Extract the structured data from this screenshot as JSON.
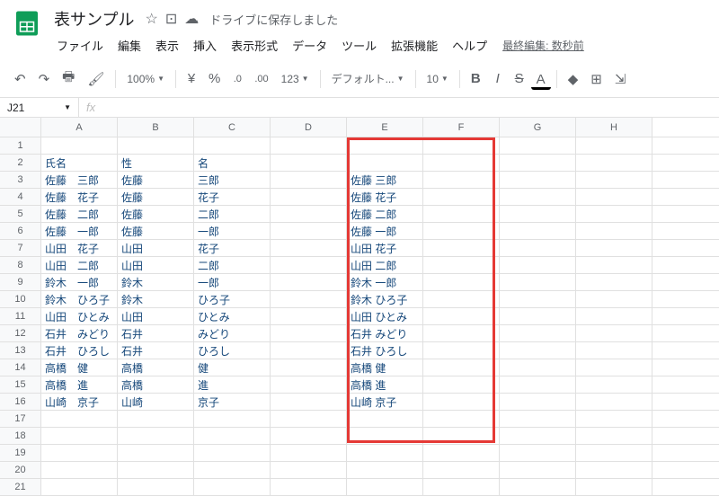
{
  "app": {
    "title": "表サンプル",
    "drive_saved": "ドライブに保存しました",
    "last_edit": "最終編集: 数秒前"
  },
  "menu": {
    "file": "ファイル",
    "edit": "編集",
    "view": "表示",
    "insert": "挿入",
    "format": "表示形式",
    "data": "データ",
    "tools": "ツール",
    "extensions": "拡張機能",
    "help": "ヘルプ"
  },
  "toolbar": {
    "zoom": "100%",
    "currency": "¥",
    "percent": "%",
    "dec_dec": ".0",
    "dec_inc": ".00",
    "more_fmt": "123",
    "font": "デフォルト...",
    "font_size": "10",
    "bold": "B",
    "italic": "I",
    "strike": "S",
    "text_color": "A"
  },
  "name_box": "J21",
  "fx": "fx",
  "columns": [
    "A",
    "B",
    "C",
    "D",
    "E",
    "F",
    "G",
    "H"
  ],
  "row_count": 21,
  "headers": {
    "a": "氏名",
    "b": "性",
    "c": "名"
  },
  "data_rows": [
    {
      "a": "佐藤　三郎",
      "b": "佐藤",
      "c": "三郎",
      "e": "佐藤 三郎"
    },
    {
      "a": "佐藤　花子",
      "b": "佐藤",
      "c": "花子",
      "e": "佐藤 花子"
    },
    {
      "a": "佐藤　二郎",
      "b": "佐藤",
      "c": "二郎",
      "e": "佐藤 二郎"
    },
    {
      "a": "佐藤　一郎",
      "b": "佐藤",
      "c": "一郎",
      "e": "佐藤 一郎"
    },
    {
      "a": "山田　花子",
      "b": "山田",
      "c": "花子",
      "e": "山田 花子"
    },
    {
      "a": "山田　二郎",
      "b": "山田",
      "c": "二郎",
      "e": "山田 二郎"
    },
    {
      "a": "鈴木　一郎",
      "b": "鈴木",
      "c": "一郎",
      "e": "鈴木 一郎"
    },
    {
      "a": "鈴木　ひろ子",
      "b": "鈴木",
      "c": "ひろ子",
      "e": "鈴木 ひろ子"
    },
    {
      "a": "山田　ひとみ",
      "b": "山田",
      "c": "ひとみ",
      "e": "山田 ひとみ"
    },
    {
      "a": "石井　みどり",
      "b": "石井",
      "c": "みどり",
      "e": "石井 みどり"
    },
    {
      "a": "石井　ひろし",
      "b": "石井",
      "c": "ひろし",
      "e": "石井 ひろし"
    },
    {
      "a": "高橋　健",
      "b": "高橋",
      "c": "健",
      "e": "高橋 健"
    },
    {
      "a": "高橋　進",
      "b": "高橋",
      "c": "進",
      "e": "高橋 進"
    },
    {
      "a": "山崎　京子",
      "b": "山崎",
      "c": "京子",
      "e": "山崎 京子"
    }
  ]
}
